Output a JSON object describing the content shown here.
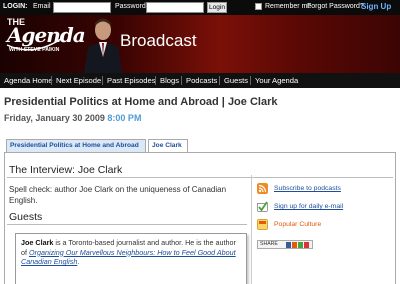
{
  "login": {
    "label": "LOGIN:",
    "email_label": "Email",
    "email_value": "",
    "password_label": "Password",
    "password_value": "",
    "login_button": "Login",
    "remember_label": "Remember me",
    "forgot_label": "Forgot Password?",
    "signup_label": "Sign Up"
  },
  "banner": {
    "logo_the": "THE",
    "logo_agenda": "Agenda",
    "logo_sub": "WITH STEVE PAIKIN",
    "section": "Broadcast"
  },
  "nav": {
    "items": [
      {
        "label": "Agenda Home"
      },
      {
        "label": "Next Episode"
      },
      {
        "label": "Past Episodes"
      },
      {
        "label": "Blogs"
      },
      {
        "label": "Podcasts"
      },
      {
        "label": "Guests"
      },
      {
        "label": "Your Agenda"
      }
    ]
  },
  "page": {
    "title": "Presidential Politics at Home and Abroad | Joe Clark",
    "date": "Friday, January 30 2009",
    "time": "8:00 PM"
  },
  "tabs": [
    {
      "label": "Presidential Politics at Home and Abroad"
    },
    {
      "label": "Joe Clark"
    }
  ],
  "interview": {
    "heading": "The Interview: Joe Clark",
    "description": "Spell check: author Joe Clark on the uniqueness of Canadian English.",
    "guests_heading": "Guests",
    "guest_name": "Joe Clark",
    "guest_bio": " is a Toronto-based journalist and author. He is the author of ",
    "guest_book": "Organizing Our Marvellous Neighbours: How to Feel Good About Canadian English",
    "guest_bio_end": "."
  },
  "sidebar": {
    "subscribe": "Subscribe to podcasts",
    "email": "Sign up for daily e-mail",
    "culture": "Popular Culture",
    "share": "SHARE"
  },
  "colors": {
    "banner_dark": "#4a0603",
    "nav_bg": "#111111",
    "link": "#1c4e9c",
    "time": "#4f9ad8",
    "signup": "#6fb2ff",
    "culture": "#e05b0b",
    "rss": "#f08a24",
    "check": "#4aa23a"
  }
}
